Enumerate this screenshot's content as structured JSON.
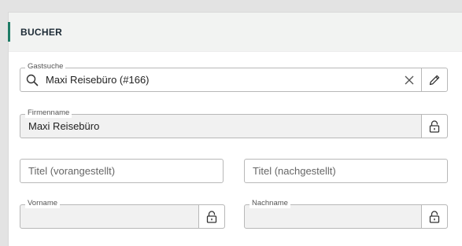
{
  "panel": {
    "title": "BUCHER"
  },
  "guest_search": {
    "label": "Gastsuche",
    "value": "Maxi Reisebüro (#166)",
    "icons": [
      "search-icon",
      "clear-icon",
      "pencil-icon"
    ]
  },
  "company_name": {
    "label": "Firmenname",
    "value": "Maxi Reisebüro",
    "icon": "lock-icon"
  },
  "title_prefix": {
    "placeholder": "Titel (vorangestellt)"
  },
  "title_suffix": {
    "placeholder": "Titel (nachgestellt)"
  },
  "first_name": {
    "label": "Vorname",
    "value": "",
    "icon": "lock-icon"
  },
  "last_name": {
    "label": "Nachname",
    "value": "",
    "icon": "lock-icon"
  },
  "colors": {
    "accent": "#1e7b66",
    "border": "#b8b8b8",
    "readonly_bg": "#f1f1f1"
  }
}
